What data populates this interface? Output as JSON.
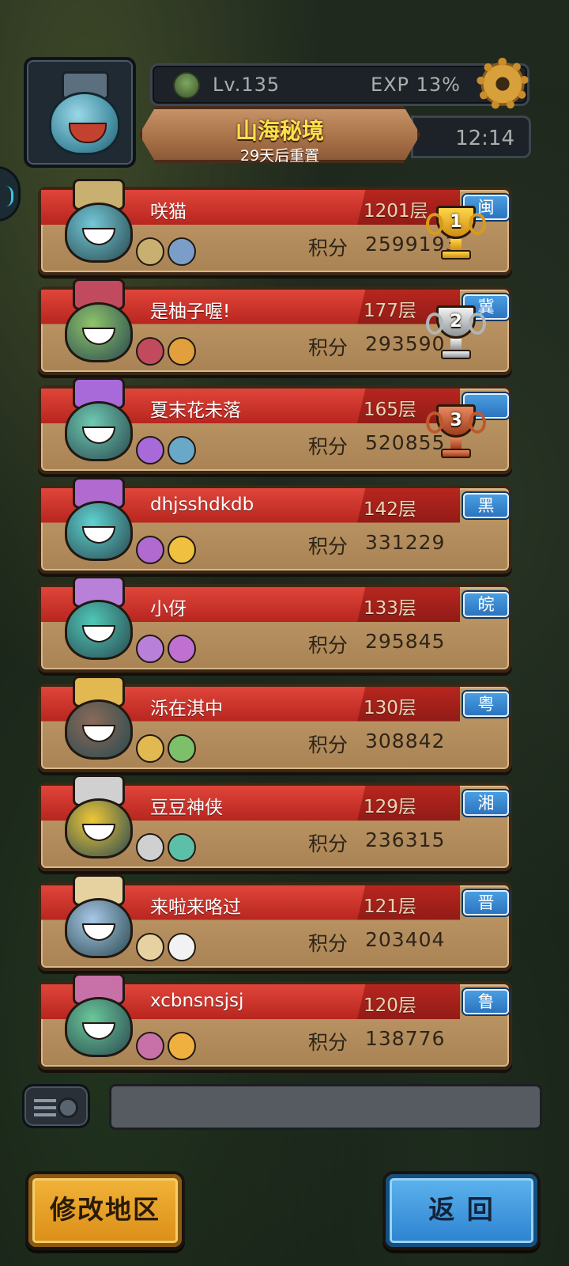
{
  "header": {
    "level": "Lv.135",
    "exp": "EXP 13%",
    "title": "山海秘境",
    "reset_text": "29天后重置",
    "time": "12:14"
  },
  "ranking": [
    {
      "name": "咲猫",
      "floor": "1201层",
      "score_label": "积分",
      "score": "2599193",
      "region": "闽",
      "trophy": "gold",
      "trophy_num": "1",
      "colors": [
        "#73c8d8",
        "#c9b070",
        "#7a9ec8"
      ]
    },
    {
      "name": "是柚子喔!",
      "floor": "177层",
      "score_label": "积分",
      "score": "293590",
      "region": "冀",
      "trophy": "silver",
      "trophy_num": "2",
      "colors": [
        "#8fc46a",
        "#c24a5e",
        "#e2a03c"
      ]
    },
    {
      "name": "夏末花未落",
      "floor": "165层",
      "score_label": "积分",
      "score": "520855",
      "region": "",
      "trophy": "bronze",
      "trophy_num": "3",
      "colors": [
        "#6fcab2",
        "#a86ad8",
        "#6aa8c8"
      ]
    },
    {
      "name": "dhjsshdkdb",
      "floor": "142层",
      "score_label": "积分",
      "score": "331229",
      "region": "黑",
      "trophy": "",
      "trophy_num": "",
      "colors": [
        "#5fd2d0",
        "#b06ad0",
        "#f0c040"
      ]
    },
    {
      "name": "小伢",
      "floor": "133层",
      "score_label": "积分",
      "score": "295845",
      "region": "皖",
      "trophy": "",
      "trophy_num": "",
      "colors": [
        "#4fc8b8",
        "#b880d8",
        "#c070d0"
      ]
    },
    {
      "name": "泺在淇中",
      "floor": "130层",
      "score_label": "积分",
      "score": "308842",
      "region": "粤",
      "trophy": "",
      "trophy_num": "",
      "colors": [
        "#8a6a58",
        "#e2b850",
        "#7cc06a"
      ]
    },
    {
      "name": "豆豆神侠",
      "floor": "129层",
      "score_label": "积分",
      "score": "236315",
      "region": "湘",
      "trophy": "",
      "trophy_num": "",
      "colors": [
        "#f0c838",
        "#d0d0d0",
        "#5cc0a8"
      ]
    },
    {
      "name": "来啦来咯过",
      "floor": "121层",
      "score_label": "积分",
      "score": "203404",
      "region": "晋",
      "trophy": "",
      "trophy_num": "",
      "colors": [
        "#a8c8e8",
        "#e6d2a0",
        "#f2f2f2"
      ]
    },
    {
      "name": "xcbnsnsjsj",
      "floor": "120层",
      "score_label": "积分",
      "score": "138776",
      "region": "鲁",
      "trophy": "",
      "trophy_num": "",
      "colors": [
        "#6ac89a",
        "#c870a8",
        "#f0b040"
      ]
    }
  ],
  "chat": {
    "value": ""
  },
  "buttons": {
    "change_region": "修改地区",
    "back": "返 回"
  },
  "accent_colors": {
    "name_band": "#c8302a",
    "region_badge": "#3b8ad6",
    "card_bg": "#b68f60"
  }
}
